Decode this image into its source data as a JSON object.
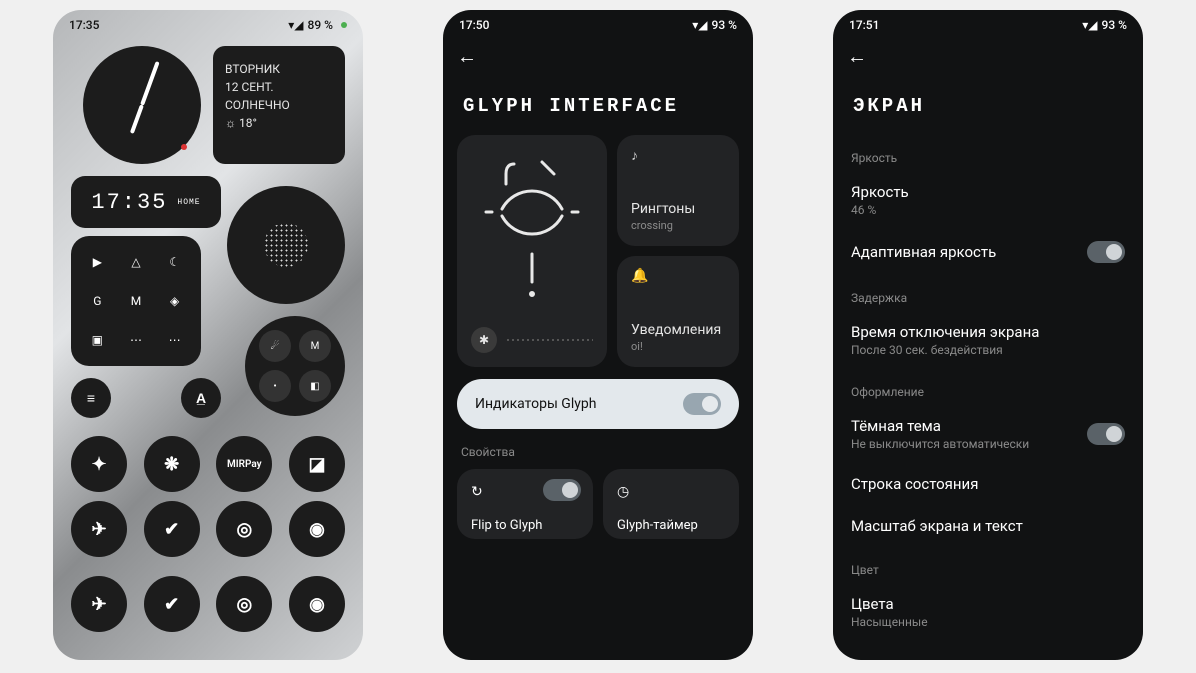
{
  "phone1": {
    "status": {
      "time": "17:35",
      "battery": "89 %"
    },
    "weather": {
      "day": "ВТОРНИК",
      "date": "12 СЕНТ.",
      "cond": "СОЛНЕЧНО",
      "temp": "☼ 18°"
    },
    "clock": {
      "time": "17:35",
      "label": "HOME"
    },
    "grid9": [
      "▶",
      "△",
      "☾",
      "G",
      "M",
      "◈",
      "▣",
      "⋯",
      "⋯"
    ],
    "folder": [
      "☄",
      "M",
      "•",
      "◧"
    ],
    "row1": [
      "≡",
      "A̲"
    ],
    "row2": [
      "✦",
      "❋",
      "MIRPay",
      "◪"
    ],
    "row3": [
      "✈",
      "✔",
      "◎",
      "◉"
    ],
    "dock": [
      "✈",
      "✔",
      "◎",
      "◉"
    ]
  },
  "phone2": {
    "status": {
      "time": "17:50",
      "battery": "93 %"
    },
    "title": "GLYPH INTERFACE",
    "ringtones": {
      "title": "Рингтоны",
      "sub": "crossing"
    },
    "notif": {
      "title": "Уведомления",
      "sub": "oi!"
    },
    "indicators": "Индикаторы Glyph",
    "section": "Свойства",
    "flip": "Flip to Glyph",
    "timer": "Glyph-таймер"
  },
  "phone3": {
    "status": {
      "time": "17:51",
      "battery": "93 %"
    },
    "title": "ЭКРАН",
    "sec_brightness": "Яркость",
    "brightness": {
      "t": "Яркость",
      "s": "46 %"
    },
    "adaptive": "Адаптивная яркость",
    "sec_delay": "Задержка",
    "timeout": {
      "t": "Время отключения экрана",
      "s": "После 30 сек. бездействия"
    },
    "sec_style": "Оформление",
    "darkmode": {
      "t": "Тёмная тема",
      "s": "Не выключится автоматически"
    },
    "statusline": "Строка состояния",
    "scale": "Масштаб экрана и текст",
    "sec_color": "Цвет",
    "colors": {
      "t": "Цвета",
      "s": "Насыщенные"
    }
  }
}
